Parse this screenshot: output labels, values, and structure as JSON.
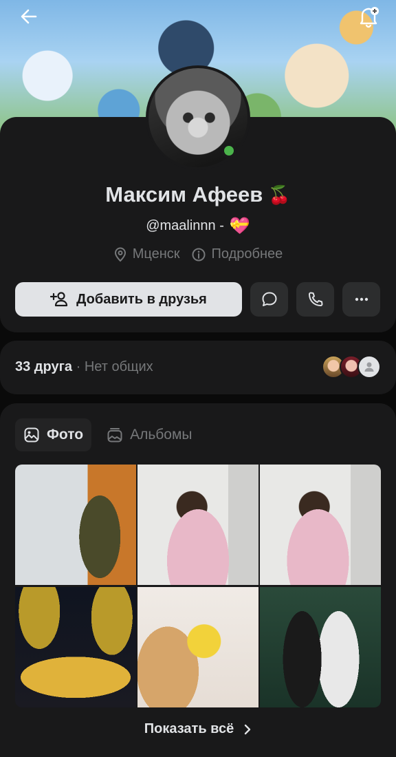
{
  "profile": {
    "name": "Максим Афеев",
    "name_emoji": "🍒",
    "status_text": "@maalinnn -",
    "status_emoji": "💝",
    "city": "Мценск",
    "details_link": "Подробнее"
  },
  "actions": {
    "add_friend_label": "Добавить в друзья"
  },
  "friends": {
    "count_text": "33 друга",
    "separator": "·",
    "mutual_text": "Нет общих"
  },
  "photos": {
    "tabs": [
      {
        "label": "Фото"
      },
      {
        "label": "Альбомы"
      }
    ],
    "show_all_label": "Показать всё"
  },
  "colors": {
    "accent_online": "#4bb34b",
    "card_bg": "#19191a"
  }
}
